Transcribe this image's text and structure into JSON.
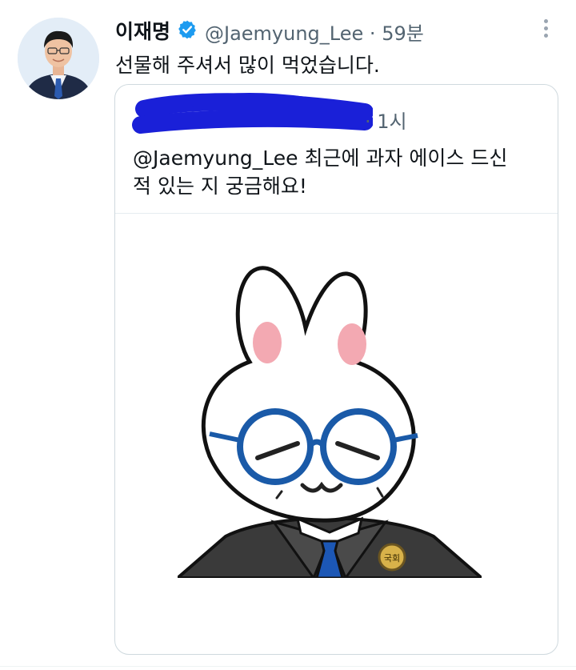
{
  "tweet": {
    "author_name": "이재명",
    "handle": "@Jaemyung_Lee",
    "time": "59분",
    "text": "선물해 주셔서 많이 먹었습니다."
  },
  "quoted_tweet": {
    "time": "1시",
    "text_line1": "@Jaemyung_Lee 최근에 과자 에이스 드신",
    "text_line2": "적 있는 지 궁금해요!",
    "badge_text": "국회"
  },
  "colors": {
    "verified": "#1d9bf0",
    "scribble": "#1a20d8",
    "glasses": "#1a5aa8",
    "tie": "#1c57b5"
  },
  "icons": [
    "verified-badge-icon",
    "more-options-icon"
  ]
}
